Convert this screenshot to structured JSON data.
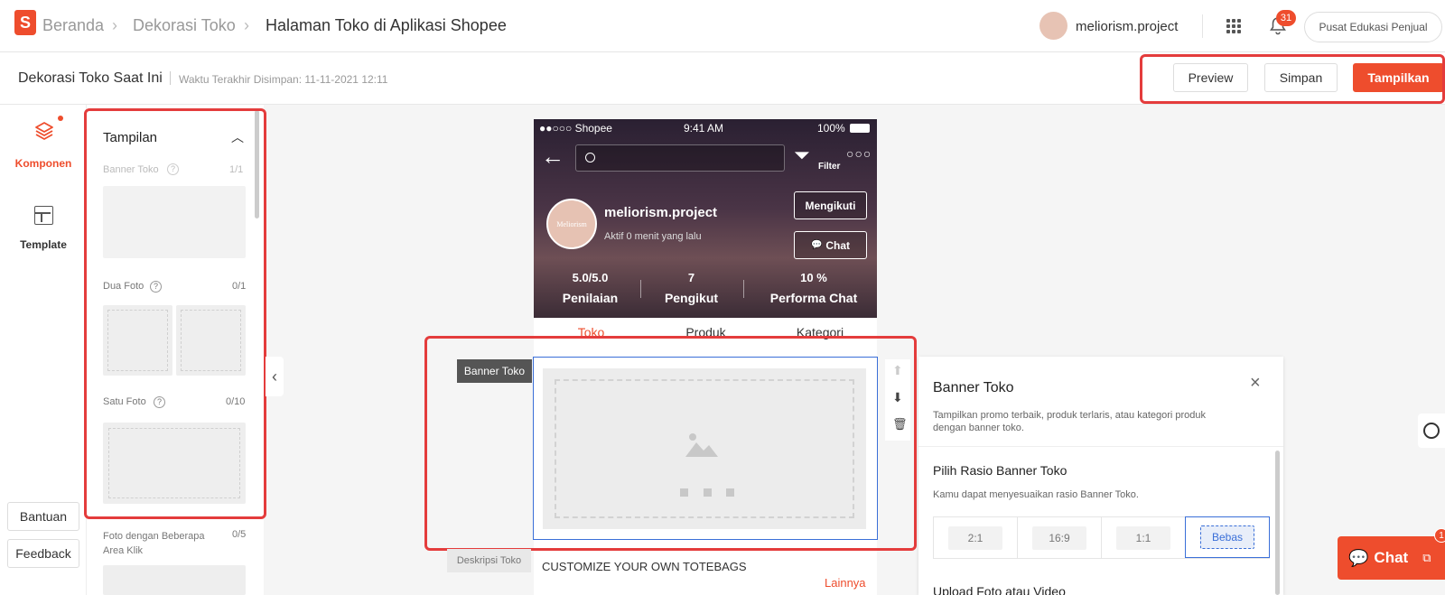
{
  "topbar": {
    "breadcrumbs": [
      "Beranda",
      "Dekorasi Toko",
      "Halaman Toko di Aplikasi Shopee"
    ],
    "username": "meliorism.project",
    "notif_count": "31",
    "edu_label": "Pusat Edukasi Penjual"
  },
  "subbar": {
    "title": "Dekorasi Toko Saat Ini",
    "saved": "Waktu Terakhir Disimpan: 11-11-2021 12:11",
    "preview": "Preview",
    "save": "Simpan",
    "publish": "Tampilkan"
  },
  "leftnav": {
    "komponen": "Komponen",
    "template": "Template",
    "help": "Bantuan",
    "feedback": "Feedback"
  },
  "panel": {
    "title": "Tampilan",
    "items": [
      {
        "label": "Banner Toko",
        "count": "1/1"
      },
      {
        "label": "Dua Foto",
        "count": "0/1"
      },
      {
        "label": "Satu Foto",
        "count": "0/10"
      },
      {
        "label": "Foto dengan Beberapa Area Klik",
        "count": "0/5"
      }
    ]
  },
  "phone": {
    "carrier": "●●○○○ Shopee",
    "time": "9:41 AM",
    "battery": "100%",
    "filter": "Filter",
    "shop_name": "meliorism.project",
    "active": "Aktif 0 menit yang lalu",
    "avatar_text": "Meliorism",
    "follow": "Mengikuti",
    "chat": "Chat",
    "stats": [
      {
        "value": "5.0/5.0",
        "label": "Penilaian"
      },
      {
        "value": "7",
        "label": "Pengikut"
      },
      {
        "value": "10 %",
        "label": "Performa Chat"
      }
    ],
    "tabs": [
      "Toko",
      "Produk",
      "Kategori"
    ],
    "desc_text": "CUSTOMIZE YOUR OWN TOTEBAGS",
    "more": "Lainnya"
  },
  "canvas": {
    "banner_tag": "Banner Toko",
    "desc_tag": "Deskripsi Toko"
  },
  "sidepanel": {
    "title": "Banner Toko",
    "desc": "Tampilkan promo terbaik, produk terlaris, atau kategori produk dengan banner toko.",
    "ratio_title": "Pilih Rasio Banner Toko",
    "ratio_desc": "Kamu dapat menyesuaikan rasio Banner Toko.",
    "ratios": [
      "2:1",
      "16:9",
      "1:1",
      "Bebas"
    ],
    "upload_title": "Upload Foto atau Video"
  },
  "chatbtn": {
    "label": "Chat",
    "badge": "1"
  },
  "colors": {
    "brand": "#ee4d2d",
    "highlight": "#e43c3c",
    "selected": "#3a6fd8"
  }
}
